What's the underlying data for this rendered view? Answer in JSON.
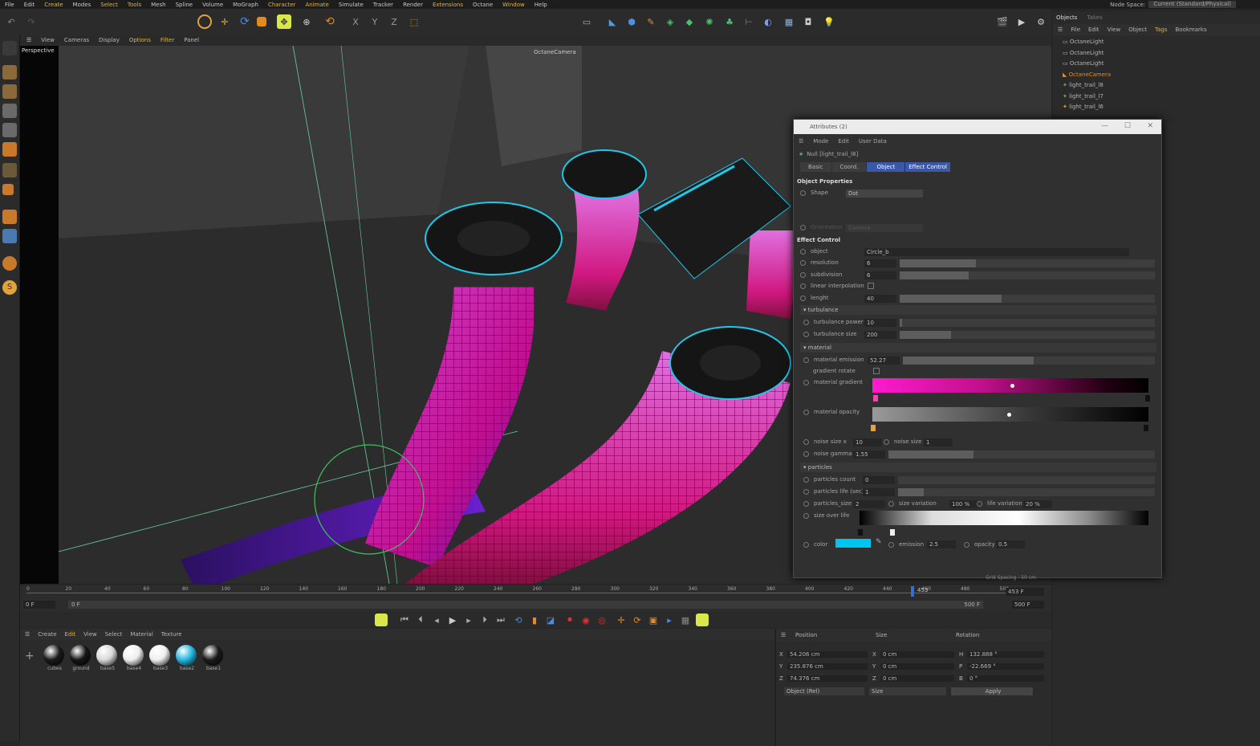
{
  "menubar": {
    "items": [
      "File",
      "Edit",
      "Create",
      "Modes",
      "Select",
      "Tools",
      "Mesh",
      "Spline",
      "Volume",
      "MoGraph",
      "Character",
      "Animate",
      "Simulate",
      "Tracker",
      "Render",
      "Extensions",
      "Octane",
      "Window",
      "Help"
    ],
    "node_space_label": "Node Space:",
    "node_space_value": "Current (Standard/Physical)"
  },
  "viewport": {
    "menu": [
      "View",
      "Cameras",
      "Display",
      "Options",
      "Filter",
      "Panel"
    ],
    "label": "Perspective",
    "camera_label": "OctaneCamera"
  },
  "object_manager": {
    "tabs": [
      "Objects",
      "Takes"
    ],
    "menu": [
      "File",
      "Edit",
      "View",
      "Object",
      "Tags",
      "Bookmarks"
    ],
    "objects": [
      "OctaneLight",
      "OctaneLight",
      "OctaneLight",
      "OctaneCamera",
      "light_trail_l8",
      "light_trail_l7",
      "light_trail_l6"
    ]
  },
  "attributes": {
    "title": "Attributes (2)",
    "menu": [
      "Mode",
      "Edit",
      "User Data"
    ],
    "object_name": "Null [light_trail_l8]",
    "tabs": [
      "Basic",
      "Coord.",
      "Object",
      "Effect Control"
    ],
    "object_properties": {
      "heading": "Object Properties",
      "shape_label": "Shape",
      "shape_value": "Dot",
      "orientation_label": "Orientation",
      "orientation_value": "Camera"
    },
    "effect_control": {
      "heading": "Effect Control",
      "object_label": "object",
      "object_value": "Circle_b",
      "resolution_label": "resolution",
      "resolution_value": "6",
      "resolution_fill": 0.3,
      "subdivision_label": "subdivision",
      "subdivision_value": "6",
      "subdivision_fill": 0.27,
      "linear_label": "linear interpolation",
      "lenght_label": "lenght",
      "lenght_value": "40",
      "lenght_fill": 0.4
    },
    "turbulance": {
      "heading": "turbulance",
      "power_label": "turbulance power",
      "power_value": "10",
      "power_fill": 0.01,
      "size_label": "turbulance size",
      "size_value": "200",
      "size_fill": 0.2
    },
    "material": {
      "heading": "material",
      "emission_label": "material emission",
      "emission_value": "52.27",
      "emission_fill": 0.52,
      "gradient_rotate_label": "gradient rotate",
      "gradient_label": "material gradient",
      "opacity_label": "material opacity",
      "noise_x_label": "noise size x",
      "noise_x_value": "10",
      "noise_y_label": "noise size y",
      "noise_y_value": "1",
      "gamma_label": "noise gamma",
      "gamma_value": "1.55",
      "gamma_fill": 0.32
    },
    "particles": {
      "heading": "particles",
      "count_label": "particles count",
      "count_value": "0",
      "life_label": "particles life (sec)",
      "life_value": "1",
      "size_label": "particles_size",
      "size_value": "2",
      "size_var_label": "size variation",
      "size_var_value": "100 %",
      "life_var_label": "life variation",
      "life_var_value": "20 %",
      "size_over_life_label": "size over life",
      "color_label": "color",
      "color_hex": "#00c4f0",
      "emission_label": "emission",
      "emission_value": "2.5",
      "opacity_label": "opacity",
      "opacity_value": "0.5"
    },
    "grid_spacing": "Grid Spacing : 50 cm"
  },
  "timeline": {
    "ticks": [
      "0",
      "20",
      "40",
      "60",
      "80",
      "100",
      "120",
      "140",
      "160",
      "180",
      "200",
      "220",
      "240",
      "260",
      "280",
      "300",
      "320",
      "340",
      "360",
      "380",
      "400",
      "420",
      "440",
      "460",
      "480",
      "500"
    ],
    "current_frame": "453 F",
    "start": "0 F",
    "start2": "0 F",
    "end": "500 F",
    "end2": "500 F",
    "marker": "453"
  },
  "material_manager": {
    "menu": [
      "Create",
      "Edit",
      "View",
      "Select",
      "Material",
      "Texture"
    ],
    "materials": [
      {
        "name": "cubes",
        "color": "#1a1a1a"
      },
      {
        "name": "ground",
        "color": "#151515"
      },
      {
        "name": "base5",
        "color": "#d8d8d8"
      },
      {
        "name": "base4",
        "color": "#eeeeee"
      },
      {
        "name": "base3",
        "color": "#efefef"
      },
      {
        "name": "base2",
        "color": "#27b6e0"
      },
      {
        "name": "base1",
        "color": "#1b1b1b"
      }
    ]
  },
  "coordinates": {
    "headers": [
      "Position",
      "Size",
      "Rotation"
    ],
    "rows": [
      {
        "axis": "X",
        "pos": "54.206 cm",
        "size_axis": "X",
        "size": "0 cm",
        "rot_axis": "H",
        "rot": "132.888 °"
      },
      {
        "axis": "Y",
        "pos": "235.876 cm",
        "size_axis": "Y",
        "size": "0 cm",
        "rot_axis": "P",
        "rot": "-22.669 °"
      },
      {
        "axis": "Z",
        "pos": "74.376 cm",
        "size_axis": "Z",
        "size": "0 cm",
        "rot_axis": "B",
        "rot": "0 °"
      }
    ],
    "mode": "Object (Rel)",
    "size_mode": "Size",
    "apply": "Apply"
  },
  "colors": {
    "accent": "#e2b23c",
    "magenta": "#e020c0",
    "cyan": "#20c8e8",
    "green": "#3ec25a",
    "tab_active": "#3a57a8"
  }
}
